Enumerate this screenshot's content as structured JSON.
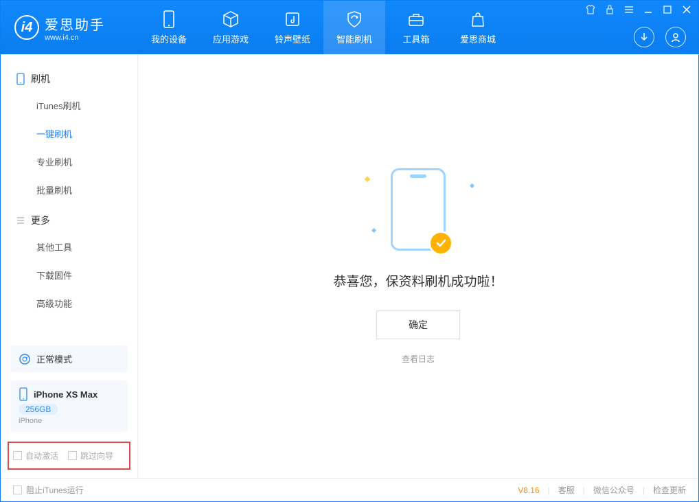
{
  "app": {
    "title": "爱思助手",
    "subtitle": "www.i4.cn"
  },
  "nav": [
    {
      "label": "我的设备",
      "icon": "device"
    },
    {
      "label": "应用游戏",
      "icon": "cube"
    },
    {
      "label": "铃声壁纸",
      "icon": "music"
    },
    {
      "label": "智能刷机",
      "icon": "shield"
    },
    {
      "label": "工具箱",
      "icon": "toolbox"
    },
    {
      "label": "爱思商城",
      "icon": "bag"
    }
  ],
  "nav_active_index": 3,
  "sidebar": {
    "group1": {
      "title": "刷机",
      "items": [
        "iTunes刷机",
        "一键刷机",
        "专业刷机",
        "批量刷机"
      ],
      "active_index": 1
    },
    "group2": {
      "title": "更多",
      "items": [
        "其他工具",
        "下载固件",
        "高级功能"
      ]
    }
  },
  "mode_card": {
    "label": "正常模式"
  },
  "device_card": {
    "name": "iPhone XS Max",
    "storage": "256GB",
    "type": "iPhone"
  },
  "options": {
    "auto_activate": "自动激活",
    "skip_guide": "跳过向导"
  },
  "main": {
    "success_text": "恭喜您，保资料刷机成功啦！",
    "ok": "确定",
    "view_log": "查看日志"
  },
  "footer": {
    "block_itunes": "阻止iTunes运行",
    "version": "V8.16",
    "cs": "客服",
    "wechat": "微信公众号",
    "update": "检查更新"
  }
}
